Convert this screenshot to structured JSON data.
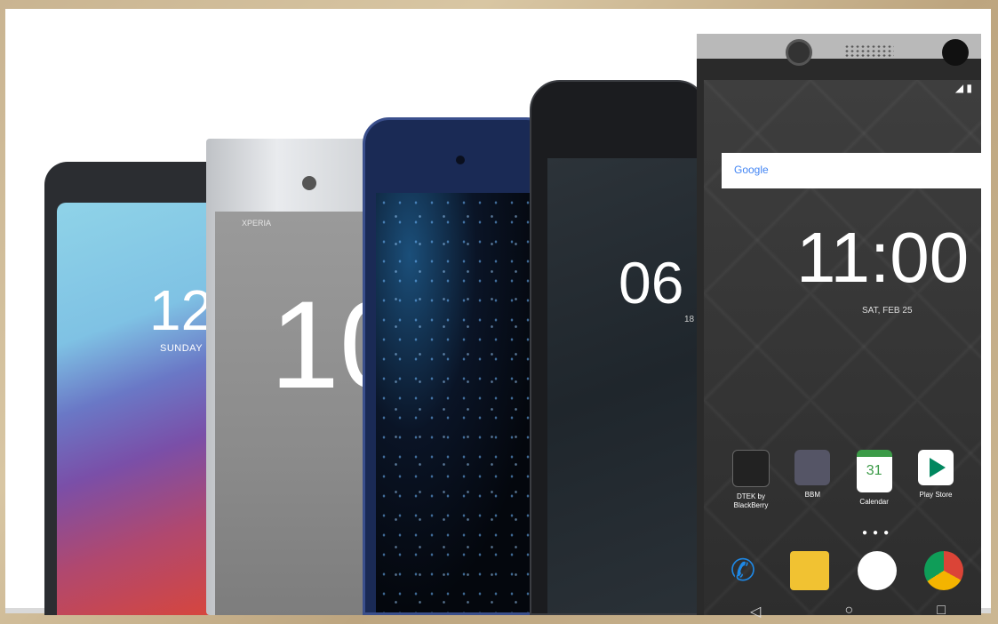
{
  "phones": {
    "lg": {
      "time": "12",
      "day": "SUNDAY"
    },
    "sony": {
      "brand": "XPERIA",
      "time": "10"
    },
    "nokia": {
      "time": "06",
      "date": "18"
    },
    "blackberry": {
      "search_label": "Google",
      "time": "11:00",
      "date": "SAT, FEB 25",
      "apps": [
        {
          "label": "DTEK by BlackBerry",
          "icon": "dtek-icon"
        },
        {
          "label": "BBM",
          "icon": "bbm-icon"
        },
        {
          "label": "Calendar",
          "icon": "calendar-icon"
        },
        {
          "label": "Play Store",
          "icon": "play-store-icon"
        }
      ],
      "calendar_day": "31"
    }
  }
}
